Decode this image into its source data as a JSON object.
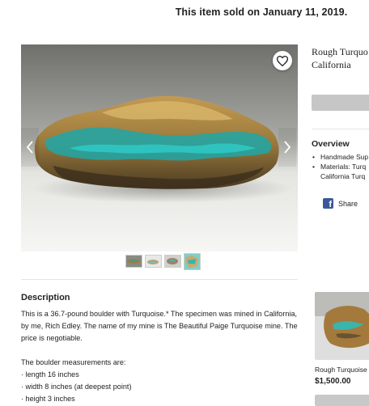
{
  "banner": {
    "sold_text": "This item sold on January 11, 2019."
  },
  "listing": {
    "title_line1": "Rough Turquo",
    "title_line2": "California",
    "favorite_icon": "heart-icon",
    "thumbnails_count_visible": 4
  },
  "overview": {
    "title": "Overview",
    "items": [
      {
        "line1": "Handmade Sup"
      },
      {
        "line1": "Materials: Turq",
        "line2": "California Turq"
      }
    ],
    "share_label": "Share"
  },
  "description": {
    "title": "Description",
    "paragraph1": "This is a 36.7-pound boulder with Turquoise.* The specimen was mined in California, by me, Rich Edley. The name of my mine is The Beautiful Paige Turquoise mine. The price is negotiable.",
    "paragraph2": "The boulder measurements are:",
    "bullets": [
      "· length 16 inches",
      "· width 8 inches (at deepest point)",
      "· height 3 inches"
    ]
  },
  "recommendation": {
    "title": "Rough Turquoise",
    "price": "$1,500.00"
  },
  "colors": {
    "facebook": "#3b5998",
    "button_disabled": "#c6c6c6",
    "turquoise": "#1fa7a8"
  }
}
